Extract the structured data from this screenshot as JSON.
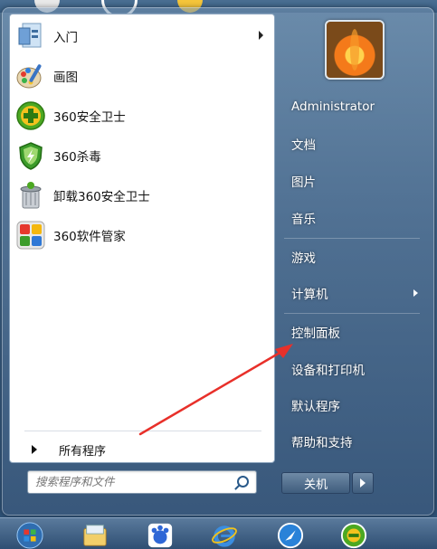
{
  "programs": [
    {
      "label": "入门",
      "icon": "getting-started-icon",
      "has_submenu": true
    },
    {
      "label": "画图",
      "icon": "paint-icon",
      "has_submenu": false
    },
    {
      "label": "360安全卫士",
      "icon": "360-security-icon",
      "has_submenu": false
    },
    {
      "label": "360杀毒",
      "icon": "360-antivirus-icon",
      "has_submenu": false
    },
    {
      "label": "卸载360安全卫士",
      "icon": "uninstall-icon",
      "has_submenu": false
    },
    {
      "label": "360软件管家",
      "icon": "360-software-manager-icon",
      "has_submenu": false
    }
  ],
  "all_programs": "所有程序",
  "search": {
    "placeholder": "搜索程序和文件"
  },
  "right": {
    "user": "Administrator",
    "items": [
      {
        "label": "文档"
      },
      {
        "label": "图片"
      },
      {
        "label": "音乐"
      },
      {
        "label": "游戏"
      },
      {
        "label": "计算机",
        "has_submenu": true
      },
      {
        "label": "控制面板"
      },
      {
        "label": "设备和打印机"
      },
      {
        "label": "默认程序"
      },
      {
        "label": "帮助和支持"
      }
    ]
  },
  "shutdown_label": "关机",
  "colors": {
    "annotation_arrow": "#e8302a",
    "menu_frame": "#3e6388"
  }
}
